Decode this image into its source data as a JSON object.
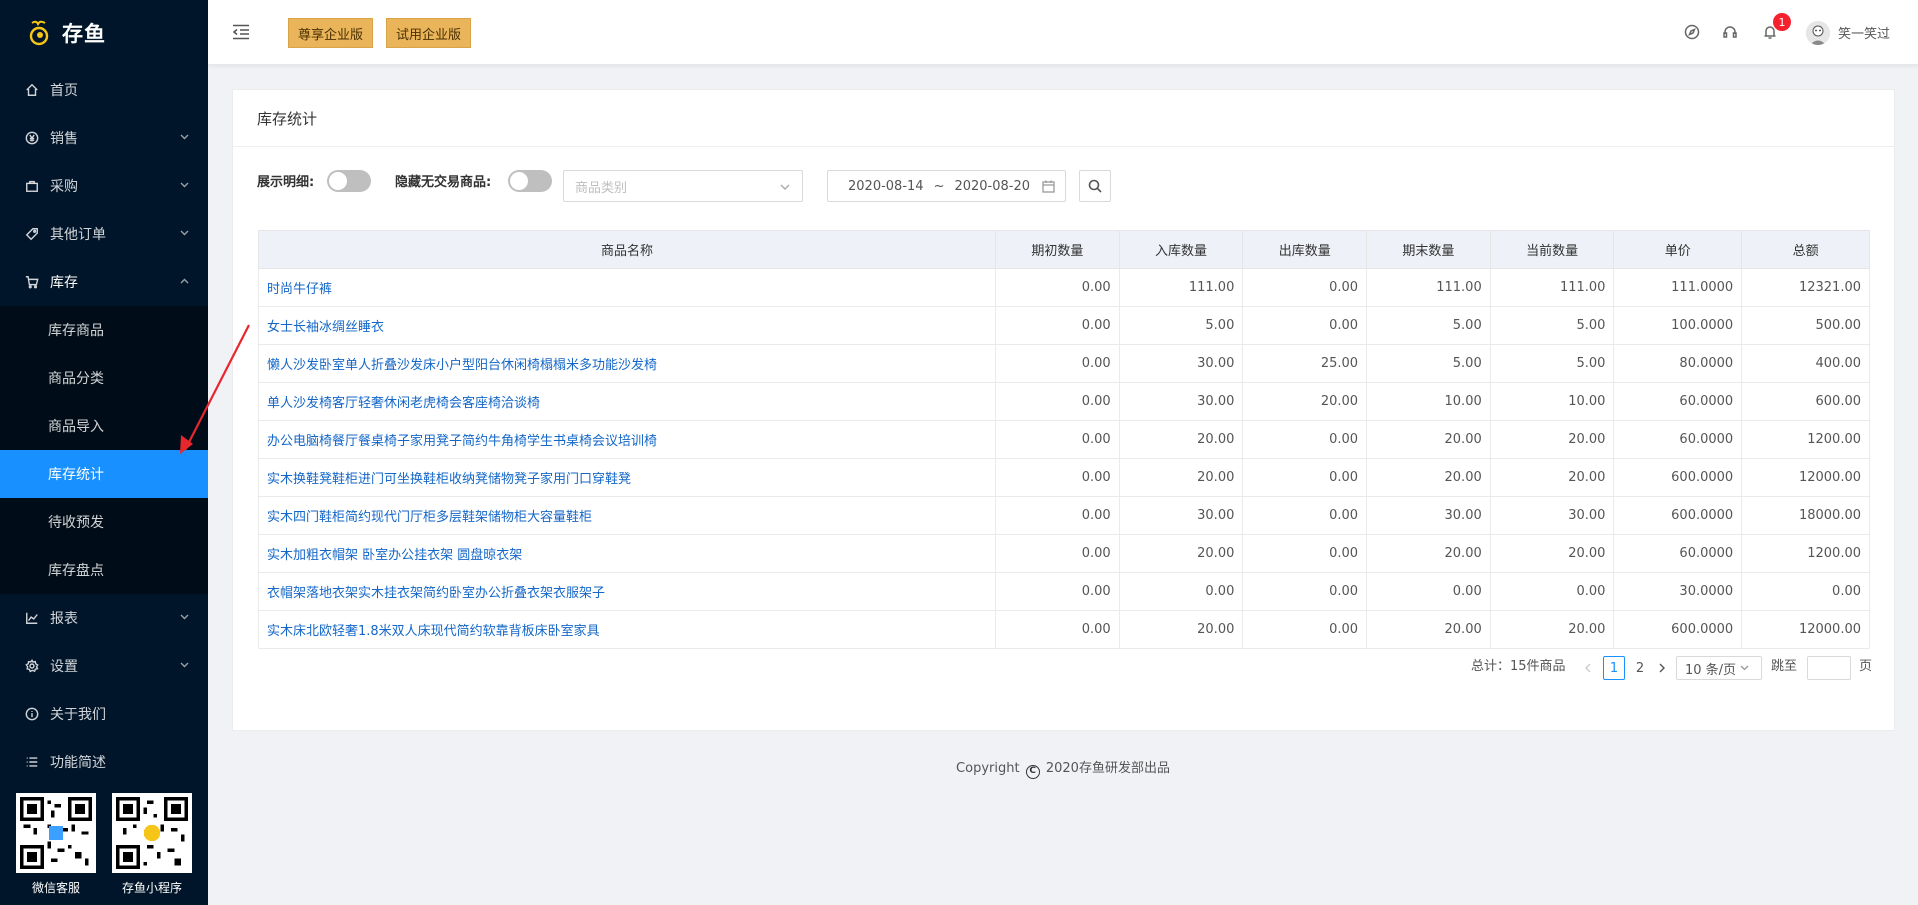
{
  "app": {
    "name": "存鱼"
  },
  "sidebar": {
    "items": [
      {
        "label": "首页",
        "icon": "home-icon"
      },
      {
        "label": "销售",
        "icon": "yen-icon"
      },
      {
        "label": "采购",
        "icon": "bag-icon"
      },
      {
        "label": "其他订单",
        "icon": "tag-icon"
      },
      {
        "label": "库存",
        "icon": "cart-icon"
      }
    ],
    "inventory_sub": [
      {
        "label": "库存商品"
      },
      {
        "label": "商品分类"
      },
      {
        "label": "商品导入"
      },
      {
        "label": "库存统计",
        "active": true
      },
      {
        "label": "待收预发"
      },
      {
        "label": "库存盘点"
      }
    ],
    "bottom_items": [
      {
        "label": "报表",
        "icon": "chart-icon"
      },
      {
        "label": "设置",
        "icon": "gear-icon"
      },
      {
        "label": "关于我们",
        "icon": "info-icon"
      },
      {
        "label": "功能简述",
        "icon": "list-icon"
      }
    ],
    "qr": [
      {
        "label": "微信客服"
      },
      {
        "label": "存鱼小程序"
      }
    ]
  },
  "header": {
    "edition_buttons": [
      "尊享企业版",
      "试用企业版"
    ],
    "notification_count": "1",
    "username": "笑一笑过"
  },
  "page": {
    "title": "库存统计",
    "filters": {
      "show_detail_label": "展示明细:",
      "hide_no_trade_label": "隐藏无交易商品:",
      "category_placeholder": "商品类别",
      "date_start": "2020-08-14",
      "date_sep": "~",
      "date_end": "2020-08-20"
    },
    "table": {
      "headers": [
        "商品名称",
        "期初数量",
        "入库数量",
        "出库数量",
        "期末数量",
        "当前数量",
        "单价",
        "总额"
      ],
      "rows": [
        [
          "时尚牛仔裤",
          "0.00",
          "111.00",
          "0.00",
          "111.00",
          "111.00",
          "111.0000",
          "12321.00"
        ],
        [
          "女士长袖冰绸丝睡衣",
          "0.00",
          "5.00",
          "0.00",
          "5.00",
          "5.00",
          "100.0000",
          "500.00"
        ],
        [
          "懒人沙发卧室单人折叠沙发床小户型阳台休闲椅榻榻米多功能沙发椅",
          "0.00",
          "30.00",
          "25.00",
          "5.00",
          "5.00",
          "80.0000",
          "400.00"
        ],
        [
          "单人沙发椅客厅轻奢休闲老虎椅会客座椅洽谈椅",
          "0.00",
          "30.00",
          "20.00",
          "10.00",
          "10.00",
          "60.0000",
          "600.00"
        ],
        [
          "办公电脑椅餐厅餐桌椅子家用凳子简约牛角椅学生书桌椅会议培训椅",
          "0.00",
          "20.00",
          "0.00",
          "20.00",
          "20.00",
          "60.0000",
          "1200.00"
        ],
        [
          "实木换鞋凳鞋柜进门可坐换鞋柜收纳凳储物凳子家用门口穿鞋凳",
          "0.00",
          "20.00",
          "0.00",
          "20.00",
          "20.00",
          "600.0000",
          "12000.00"
        ],
        [
          "实木四门鞋柜简约现代门厅柜多层鞋架储物柜大容量鞋柜",
          "0.00",
          "30.00",
          "0.00",
          "30.00",
          "30.00",
          "600.0000",
          "18000.00"
        ],
        [
          "实木加粗衣帽架 卧室办公挂衣架 圆盘晾衣架",
          "0.00",
          "20.00",
          "0.00",
          "20.00",
          "20.00",
          "60.0000",
          "1200.00"
        ],
        [
          "衣帽架落地衣架实木挂衣架简约卧室办公折叠衣架衣服架子",
          "0.00",
          "0.00",
          "0.00",
          "0.00",
          "0.00",
          "30.0000",
          "0.00"
        ],
        [
          "实木床北欧轻奢1.8米双人床现代简约软靠背板床卧室家具",
          "0.00",
          "20.00",
          "0.00",
          "20.00",
          "20.00",
          "600.0000",
          "12000.00"
        ]
      ]
    },
    "pagination": {
      "total": "总计：15件商品",
      "pages": [
        "1",
        "2"
      ],
      "page_size": "10 条/页",
      "jump_label": "跳至",
      "page_unit": "页"
    }
  },
  "footer": {
    "prefix": "Copyright",
    "text": "2020存鱼研发部出品"
  }
}
